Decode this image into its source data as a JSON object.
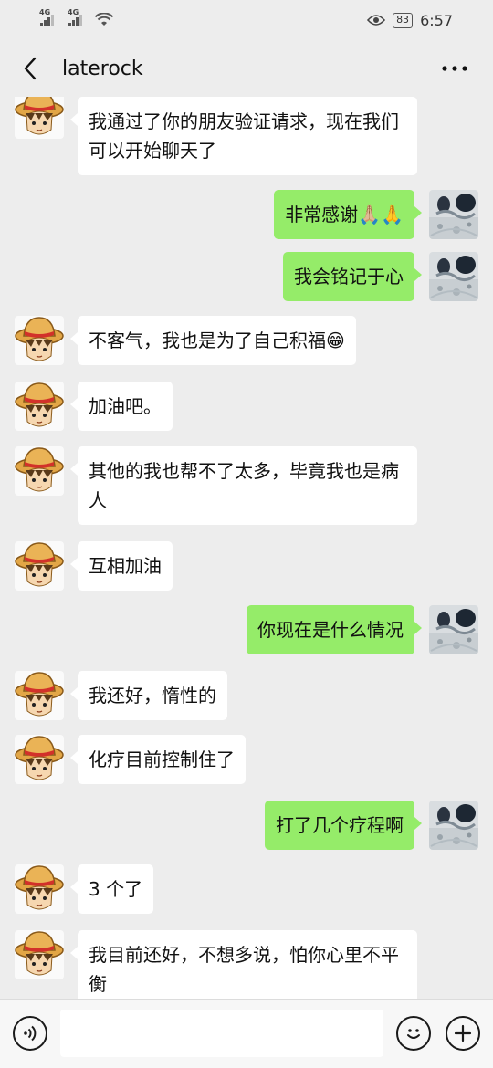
{
  "status_bar": {
    "network_1": "4G",
    "network_2": "4G",
    "battery": "83",
    "time": "6:57"
  },
  "header": {
    "title": "laterock"
  },
  "messages": [
    {
      "side": "in",
      "text": "我通过了你的朋友验证请求，现在我们可以开始聊天了"
    },
    {
      "side": "out",
      "text": "非常感谢🙏🏼🙏"
    },
    {
      "side": "out",
      "text": "我会铭记于心"
    },
    {
      "side": "in",
      "text": "不客气，我也是为了自己积福😁"
    },
    {
      "side": "in",
      "text": "加油吧。"
    },
    {
      "side": "in",
      "text": "其他的我也帮不了太多，毕竟我也是病人"
    },
    {
      "side": "in",
      "text": "互相加油"
    },
    {
      "side": "out",
      "text": "你现在是什么情况"
    },
    {
      "side": "in",
      "text": "我还好，惰性的"
    },
    {
      "side": "in",
      "text": "化疗目前控制住了"
    },
    {
      "side": "out",
      "text": "打了几个疗程啊"
    },
    {
      "side": "in",
      "text": "3 个了"
    },
    {
      "side": "in",
      "text": "我目前还好，不想多说，怕你心里不平衡"
    }
  ],
  "input_bar": {
    "value": "",
    "voice_icon": "voice-icon",
    "emoji_icon": "emoji-icon",
    "add_icon": "plus-icon"
  },
  "colors": {
    "background": "#ededed",
    "incoming_bubble": "#ffffff",
    "outgoing_bubble": "#95ec69"
  }
}
